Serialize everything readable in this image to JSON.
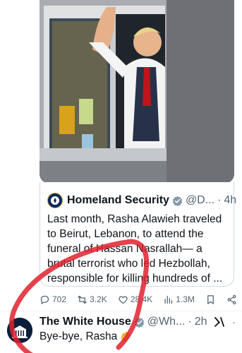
{
  "quote": {
    "name": "Homeland Security",
    "handle": "@D...",
    "separator": "·",
    "time": "4h",
    "lines": [
      "Last month, Rasha Alawieh traveled",
      "to Beirut, Lebanon, to attend the",
      "funeral of Hassan Nasrallah— a",
      "brutal terrorist who led Hezbollah,",
      "responsible for killing hundreds of ..."
    ]
  },
  "actions": {
    "replies": "702",
    "reposts": "3.2K",
    "likes": "28.4K",
    "views": "1.3M"
  },
  "next_post": {
    "name": "The White House",
    "handle": "@Wh...",
    "separator": "·",
    "time": "2h",
    "more": "···",
    "text": "Bye-bye, Rasha"
  },
  "colors": {
    "verified": "#f4b400",
    "annotation": "#e0212f",
    "muted": "#536471"
  },
  "icons": [
    "reply-icon",
    "repost-icon",
    "like-icon",
    "views-icon",
    "bookmark-icon",
    "share-icon",
    "verified-badge-icon",
    "grok-icon",
    "waving-hand-emoji"
  ]
}
